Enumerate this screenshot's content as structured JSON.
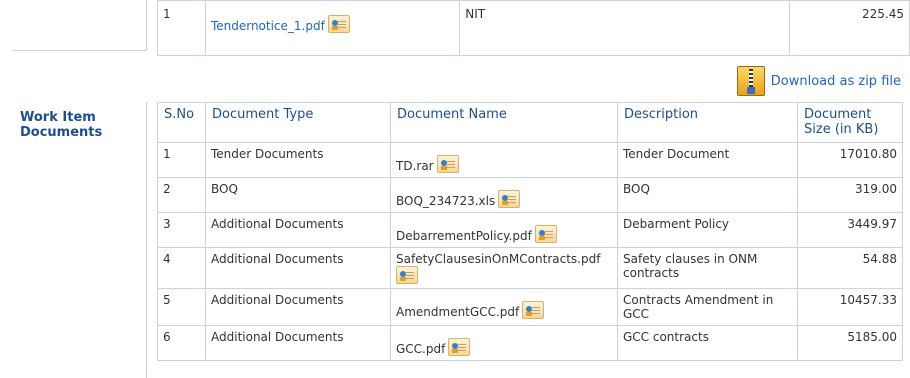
{
  "top_row": {
    "sno": "1",
    "file": "Tendernotice_1.pdf",
    "description": "NIT",
    "size": "225.45"
  },
  "download_zip_label": "Download as zip file",
  "section_title": "Work Item Documents",
  "table": {
    "headers": [
      "S.No",
      "Document Type",
      "Document Name",
      "Description",
      "Document Size (in KB)"
    ],
    "rows": [
      {
        "sno": "1",
        "type": "Tender Documents",
        "name": "TD.rar",
        "description": "Tender Document",
        "size": "17010.80"
      },
      {
        "sno": "2",
        "type": "BOQ",
        "name": "BOQ_234723.xls",
        "description": "BOQ",
        "size": "319.00"
      },
      {
        "sno": "3",
        "type": "Additional Documents",
        "name": "DebarrementPolicy.pdf",
        "description": "Debarment Policy",
        "size": "3449.97"
      },
      {
        "sno": "4",
        "type": "Additional Documents",
        "name": "SafetyClausesinOnMContracts.pdf",
        "description": "Safety clauses in ONM contracts",
        "size": "54.88"
      },
      {
        "sno": "5",
        "type": "Additional Documents",
        "name": "AmendmentGCC.pdf",
        "description": "Contracts Amendment in GCC",
        "size": "10457.33"
      },
      {
        "sno": "6",
        "type": "Additional Documents",
        "name": "GCC.pdf",
        "description": "GCC contracts",
        "size": "5185.00"
      }
    ]
  }
}
